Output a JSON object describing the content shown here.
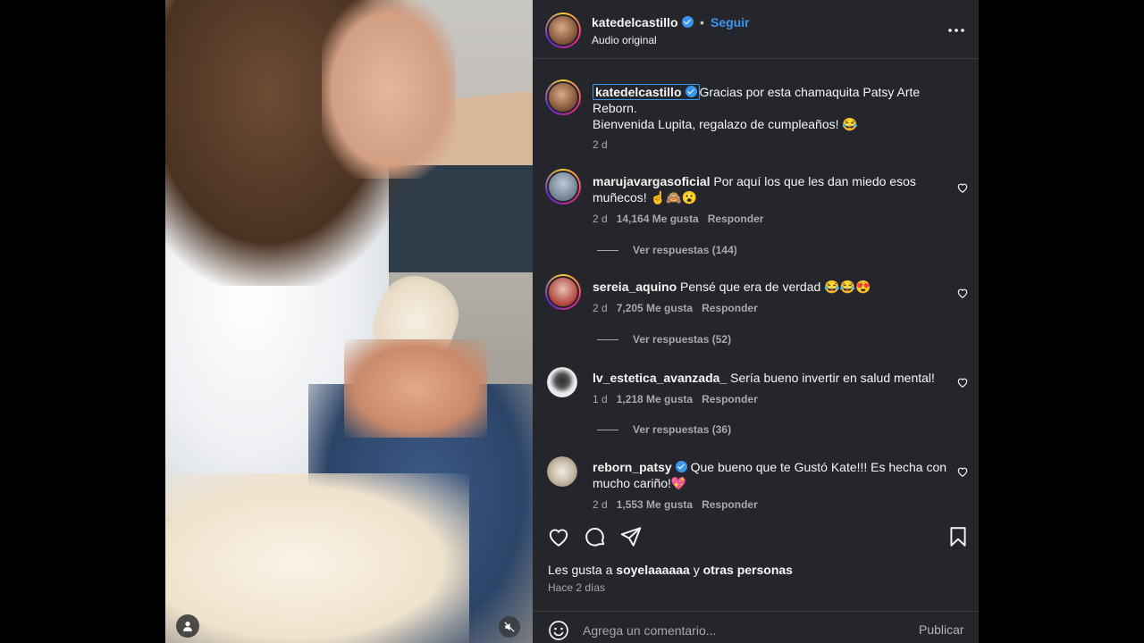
{
  "header": {
    "username": "katedelcastillo",
    "separator": "•",
    "follow_label": "Seguir",
    "audio_label": "Audio original"
  },
  "caption": {
    "username": "katedelcastillo",
    "line1": "Gracias por esta chamaquita Patsy Arte Reborn.",
    "line2": "Bienvenida Lupita, regalazo de cumpleaños! 😂",
    "time": "2 d"
  },
  "comments": [
    {
      "username": "marujavargasoficial",
      "text": "Por aquí los que les dan miedo esos muñecos! ☝️🙈😮",
      "time": "2 d",
      "likes": "14,164 Me gusta",
      "reply_label": "Responder",
      "view_replies": "Ver respuestas (144)"
    },
    {
      "username": "sereia_aquino",
      "text": "Pensé que era de verdad 😂😂😍",
      "time": "2 d",
      "likes": "7,205 Me gusta",
      "reply_label": "Responder",
      "view_replies": "Ver respuestas (52)"
    },
    {
      "username": "lv_estetica_avanzada_",
      "text": "Sería bueno invertir en salud mental!",
      "time": "1 d",
      "likes": "1,218 Me gusta",
      "reply_label": "Responder",
      "view_replies": "Ver respuestas (36)"
    },
    {
      "username": "reborn_patsy",
      "text": "Que bueno que te Gustó Kate!!! Es hecha con mucho cariño!💖",
      "time": "2 d",
      "likes": "1,553 Me gusta",
      "reply_label": "Responder"
    }
  ],
  "likes_summary": {
    "prefix": "Les gusta a",
    "user": "soyelaaaaaa",
    "connector": "y",
    "others": "otras personas"
  },
  "posted_time": "Hace 2 días",
  "composer": {
    "placeholder": "Agrega un comentario...",
    "publish_label": "Publicar"
  },
  "colors": {
    "panel_bg": "#25262b",
    "accent": "#3797f0",
    "muted_text": "#a8a8a8"
  }
}
